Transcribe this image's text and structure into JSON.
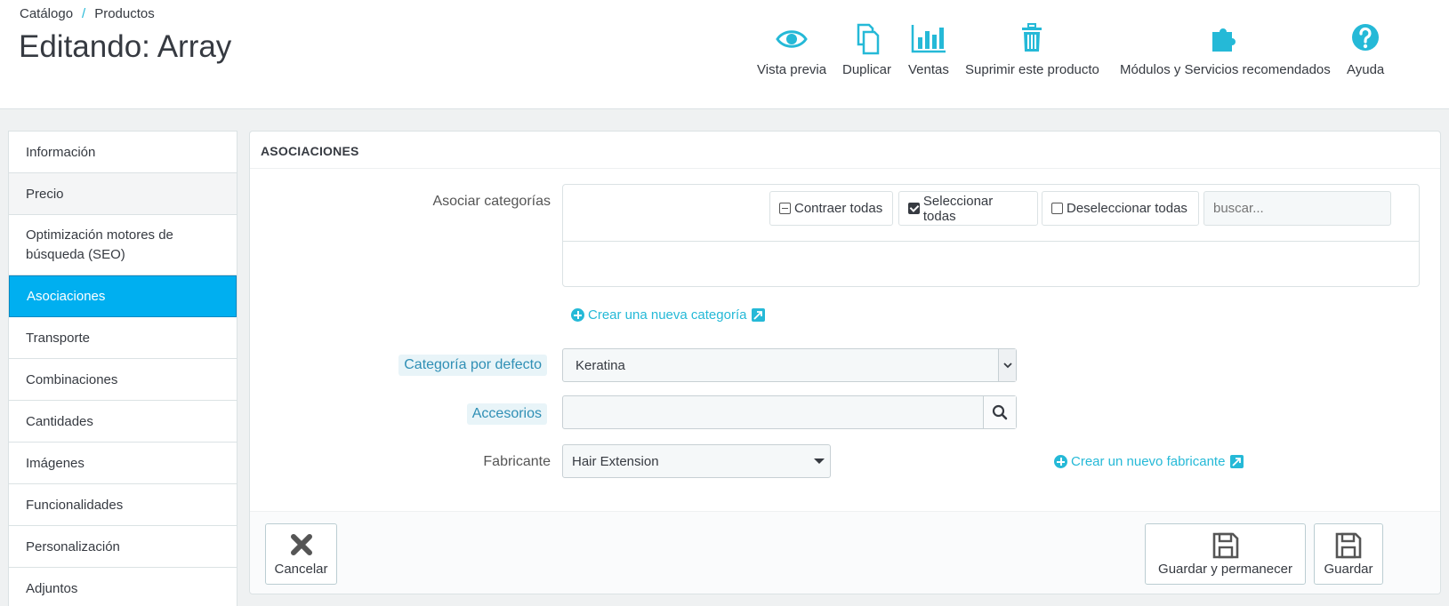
{
  "breadcrumb": {
    "parent": "Catálogo",
    "separator": "/",
    "current": "Productos"
  },
  "page_title": "Editando: Array",
  "toolbar": {
    "preview": "Vista previa",
    "duplicate": "Duplicar",
    "sales": "Ventas",
    "delete": "Suprimir este producto",
    "modules": "Módulos y Servicios recomendados",
    "help": "Ayuda"
  },
  "sidebar": {
    "items": [
      {
        "label": "Información"
      },
      {
        "label": "Precio"
      },
      {
        "label": "Optimización motores de búsqueda (SEO)"
      },
      {
        "label": "Asociaciones"
      },
      {
        "label": "Transporte"
      },
      {
        "label": "Combinaciones"
      },
      {
        "label": "Cantidades"
      },
      {
        "label": "Imágenes"
      },
      {
        "label": "Funcionalidades"
      },
      {
        "label": "Personalización"
      },
      {
        "label": "Adjuntos"
      }
    ]
  },
  "panel": {
    "heading": "ASOCIACIONES",
    "associate_label": "Asociar categorías",
    "collapse_all": "Contraer todas",
    "select_all": "Seleccionar todas",
    "deselect_all": "Deseleccionar todas",
    "search_placeholder": "buscar...",
    "new_category_link": "Crear una nueva categoría",
    "default_category_label": "Categoría por defecto",
    "default_category_value": "Keratina",
    "accessories_label": "Accesorios",
    "manufacturer_label": "Fabricante",
    "manufacturer_value": "Hair Extension",
    "new_manufacturer_link": "Crear un nuevo fabricante"
  },
  "footer": {
    "cancel": "Cancelar",
    "save_stay": "Guardar y permanecer",
    "save": "Guardar"
  },
  "colors": {
    "accent": "#25b9d7",
    "active_tab": "#00aff0",
    "text": "#363a41"
  }
}
